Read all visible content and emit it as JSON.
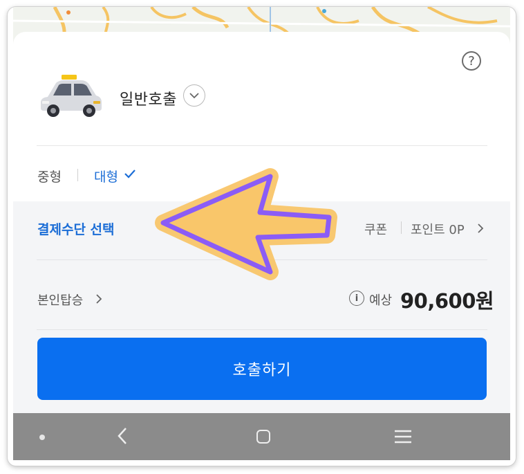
{
  "header": {
    "help_icon": "question-circle-icon",
    "call_type": "일반호출",
    "call_type_icon": "chevron-down-icon",
    "car_icon": "taxi-car-icon"
  },
  "vehicle_size": {
    "options": [
      {
        "label": "중형",
        "selected": false
      },
      {
        "label": "대형",
        "selected": true
      }
    ],
    "selected_color": "#1b6dd6"
  },
  "payment": {
    "select_label": "결제수단 선택",
    "coupon_label": "쿠폰",
    "point_label": "포인트 0P"
  },
  "ride": {
    "self_ride_label": "본인탑승",
    "estimate_label": "예상",
    "estimate_price": "90,600원"
  },
  "action": {
    "call_button_label": "호출하기",
    "button_color": "#0a6ff0"
  },
  "annotation": {
    "arrow_icon": "highlight-arrow-left-icon",
    "arrow_stroke": "#8b5cf6",
    "arrow_fill": "#f9c66a"
  },
  "system_nav": {
    "icons": [
      "dot-icon",
      "back-icon",
      "home-icon",
      "recent-apps-icon"
    ]
  }
}
